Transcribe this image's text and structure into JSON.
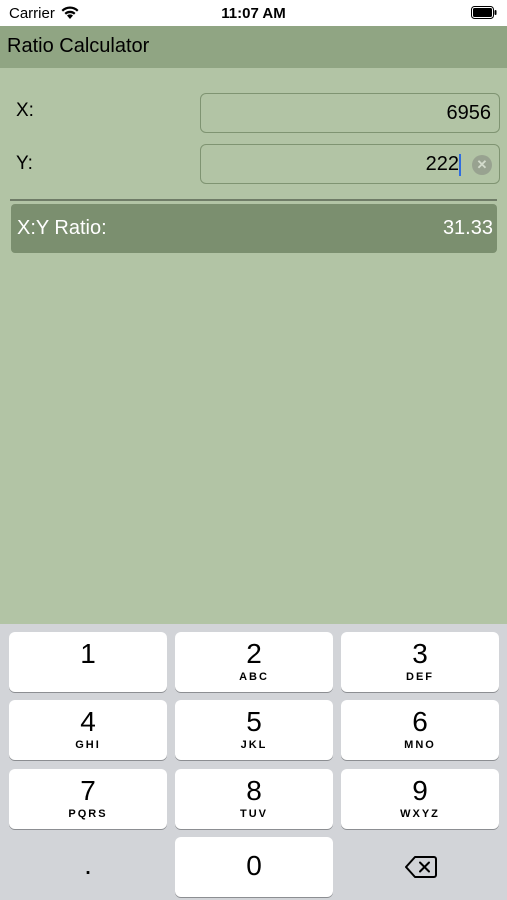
{
  "status_bar": {
    "carrier": "Carrier",
    "time": "11:07 AM"
  },
  "nav": {
    "title": "Ratio Calculator"
  },
  "form": {
    "x_label": "X:",
    "x_value": "6956",
    "y_label": "Y:",
    "y_value": "222"
  },
  "result": {
    "label": "X:Y Ratio:",
    "value": "31.33"
  },
  "keyboard": {
    "keys": [
      {
        "digit": "1",
        "letters": ""
      },
      {
        "digit": "2",
        "letters": "ABC"
      },
      {
        "digit": "3",
        "letters": "DEF"
      },
      {
        "digit": "4",
        "letters": "GHI"
      },
      {
        "digit": "5",
        "letters": "JKL"
      },
      {
        "digit": "6",
        "letters": "MNO"
      },
      {
        "digit": "7",
        "letters": "PQRS"
      },
      {
        "digit": "8",
        "letters": "TUV"
      },
      {
        "digit": "9",
        "letters": "WXYZ"
      }
    ],
    "decimal": ".",
    "zero": "0"
  },
  "icons": {
    "wifi": "wifi-icon",
    "battery": "battery-icon",
    "clear": "clear-text-icon",
    "backspace": "backspace-icon"
  },
  "colors": {
    "background": "#b2c4a5",
    "nav_bar": "#90a583",
    "result_box": "#7b8f6f",
    "cursor": "#2f6de0"
  }
}
